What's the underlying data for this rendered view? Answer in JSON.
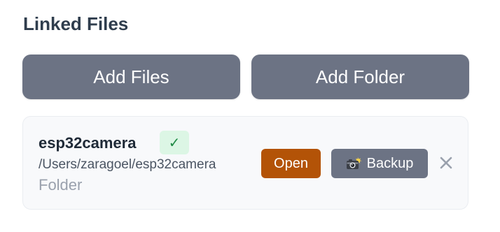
{
  "linked_files": {
    "title": "Linked Files",
    "actions": {
      "add_files_label": "Add Files",
      "add_folder_label": "Add Folder"
    },
    "items": [
      {
        "name": "esp32camera",
        "status": "✓",
        "path": "/Users/zaragoel/esp32camera",
        "type": "Folder",
        "open_label": "Open",
        "backup_label": "Backup",
        "backup_icon": "camera-flash-icon",
        "remove_icon": "close-icon"
      }
    ]
  },
  "colors": {
    "title_text": "#2f3d4d",
    "button_gray": "#6c7384",
    "open_button": "#b35307",
    "status_badge_bg": "#dcf6e5",
    "status_badge_fg": "#1f8a45",
    "card_bg": "#f8f9fb",
    "card_border": "#eaedf1",
    "muted_text": "#9aa1ad"
  }
}
